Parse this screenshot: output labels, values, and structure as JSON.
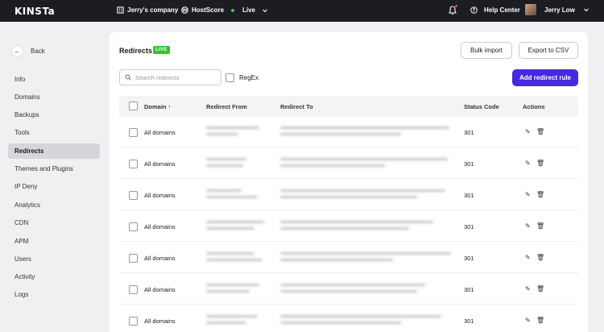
{
  "topbar": {
    "logo": "KINSTa",
    "company": "Jerry's company",
    "hostscore": "HostScore",
    "live": "Live",
    "help": "Help Center",
    "user": "Jerry Low"
  },
  "sidebar": {
    "back": "Back",
    "items": [
      "Info",
      "Domains",
      "Backups",
      "Tools",
      "Redirects",
      "Themes and Plugins",
      "IP Deny",
      "Analytics",
      "CDN",
      "APM",
      "Users",
      "Activity",
      "Logs"
    ],
    "active": "Redirects"
  },
  "main": {
    "title": "Redirects",
    "badge": "LIVE",
    "bulk_import": "Bulk import",
    "export_csv": "Export to CSV",
    "add_rule": "Add redirect rule",
    "search_placeholder": "Search redirects",
    "regex": "RegEx"
  },
  "table": {
    "headers": {
      "domain": "Domain ↑",
      "from": "Redirect From",
      "to": "Redirect To",
      "status": "Status Code",
      "actions": "Actions"
    },
    "rows": [
      {
        "domain": "All domains",
        "status": "301"
      },
      {
        "domain": "All domains",
        "status": "301"
      },
      {
        "domain": "All domains",
        "status": "301"
      },
      {
        "domain": "All domains",
        "status": "301"
      },
      {
        "domain": "All domains",
        "status": "301"
      },
      {
        "domain": "All domains",
        "status": "301"
      },
      {
        "domain": "All domains",
        "status": "301"
      }
    ]
  },
  "colors": {
    "accent": "#4828e0",
    "live": "#2ec52d",
    "topbar": "#1b1d22"
  },
  "icons": {
    "back": "arrow-left-icon",
    "edit": "pencil-icon",
    "delete": "trash-icon"
  }
}
